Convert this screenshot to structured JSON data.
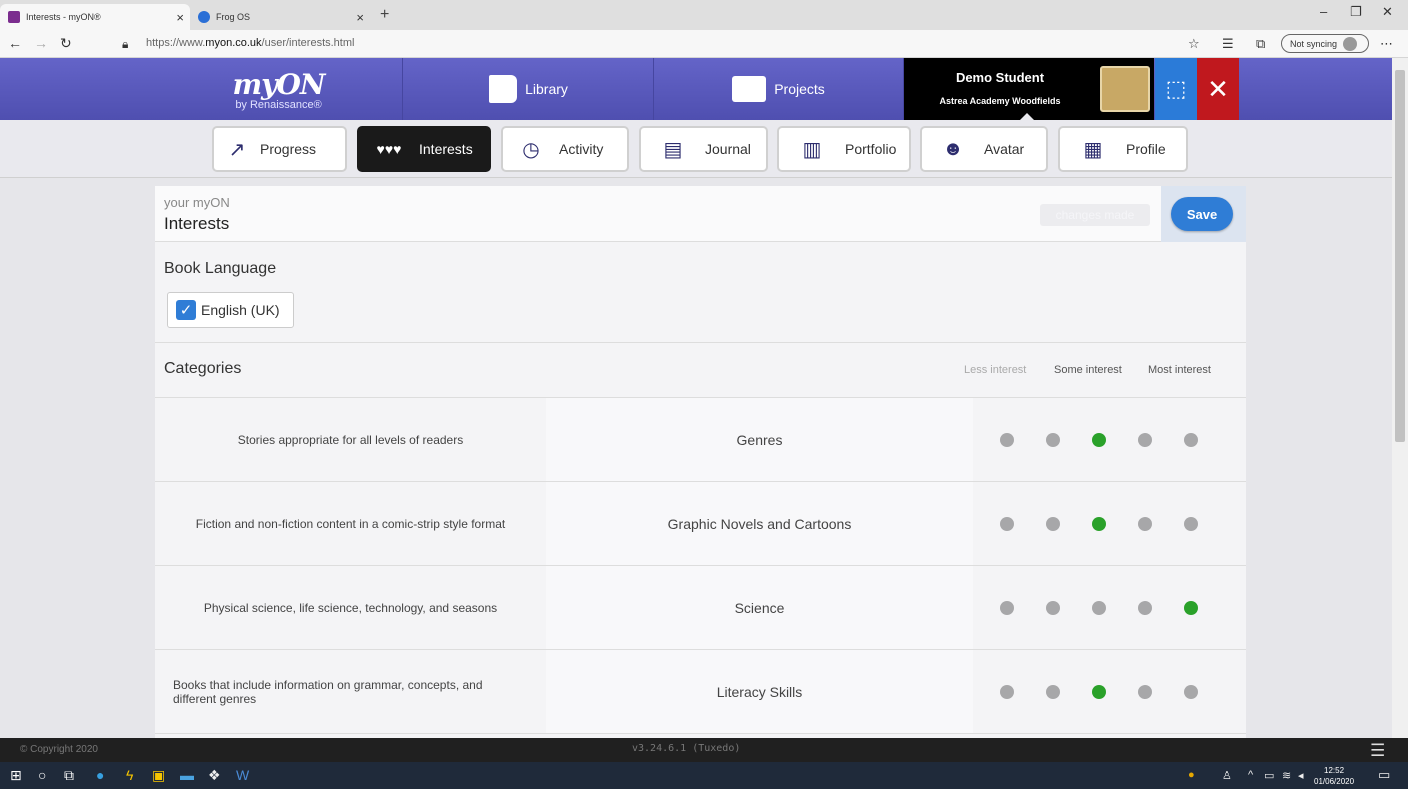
{
  "browser": {
    "tabs": [
      {
        "title": "Interests - myON®",
        "active": true
      },
      {
        "title": "Frog OS",
        "active": false
      }
    ],
    "url_prefix": "https://www.",
    "url_domain": "myon.co.uk",
    "url_path": "/user/interests.html",
    "sync_label": "Not syncing"
  },
  "header": {
    "logo": "myON",
    "logo_sub": "by Renaissance®",
    "nav": [
      {
        "label": "Library",
        "icon": "book-icon"
      },
      {
        "label": "Projects",
        "icon": "folder-icon"
      }
    ],
    "student_name": "Demo Student",
    "school": "Astrea Academy Woodfields"
  },
  "subnav": [
    {
      "label": "Progress",
      "icon": "trend-icon",
      "active": false
    },
    {
      "label": "Interests",
      "icon": "hearts-icon",
      "active": true
    },
    {
      "label": "Activity",
      "icon": "clock-icon",
      "active": false
    },
    {
      "label": "Journal",
      "icon": "journal-icon",
      "active": false
    },
    {
      "label": "Portfolio",
      "icon": "portfolio-icon",
      "active": false
    },
    {
      "label": "Avatar",
      "icon": "avatar-icon",
      "active": false
    },
    {
      "label": "Profile",
      "icon": "profile-icon",
      "active": false
    }
  ],
  "panel": {
    "title_small": "your myON",
    "title_big": "Interests",
    "changes_label": "changes made",
    "save_label": "Save",
    "book_language_heading": "Book Language",
    "language": "English (UK)",
    "categories_heading": "Categories",
    "scale": {
      "less": "Less interest",
      "some": "Some interest",
      "most": "Most interest"
    },
    "categories": [
      {
        "desc": "Stories appropriate for all levels of readers",
        "name": "Genres",
        "level": 3
      },
      {
        "desc": "Fiction and non-fiction content in a comic-strip style format",
        "name": "Graphic Novels and Cartoons",
        "level": 3
      },
      {
        "desc": "Physical science, life science, technology, and seasons",
        "name": "Science",
        "level": 5
      },
      {
        "desc": "Books that include information on grammar, concepts, and different genres",
        "name": "Literacy Skills",
        "level": 3
      }
    ]
  },
  "footer": {
    "copyright": "© Copyright 2020",
    "version": "v3.24.6.1 (Tuxedo)"
  },
  "taskbar": {
    "time": "12:52",
    "date": "01/06/2020"
  },
  "colors": {
    "header": "#5b5bbf",
    "save": "#2f7dd6",
    "dot_on": "#2aa12a",
    "dot_off": "#a7a7a9"
  }
}
